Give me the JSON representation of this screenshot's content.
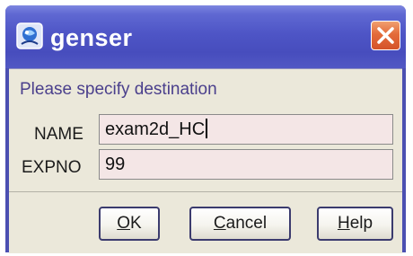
{
  "window": {
    "title": "genser",
    "icon": "genser-app-icon",
    "close_icon": "close-icon"
  },
  "dialog": {
    "prompt": "Please specify destination",
    "fields": [
      {
        "label": "NAME",
        "value": "exam2d_HC"
      },
      {
        "label": "EXPNO",
        "value": "99"
      }
    ]
  },
  "buttons": {
    "ok": {
      "mnemonic": "O",
      "rest": "K"
    },
    "cancel": {
      "mnemonic": "C",
      "rest": "ancel"
    },
    "help": {
      "mnemonic": "H",
      "rest": "elp"
    }
  },
  "colors": {
    "titlebar": "#4e55c6",
    "close_button": "#e46b3a",
    "dialog_background": "#ebe8da",
    "prompt_text": "#4a3f8c",
    "field_background": "#f4e6e6"
  }
}
